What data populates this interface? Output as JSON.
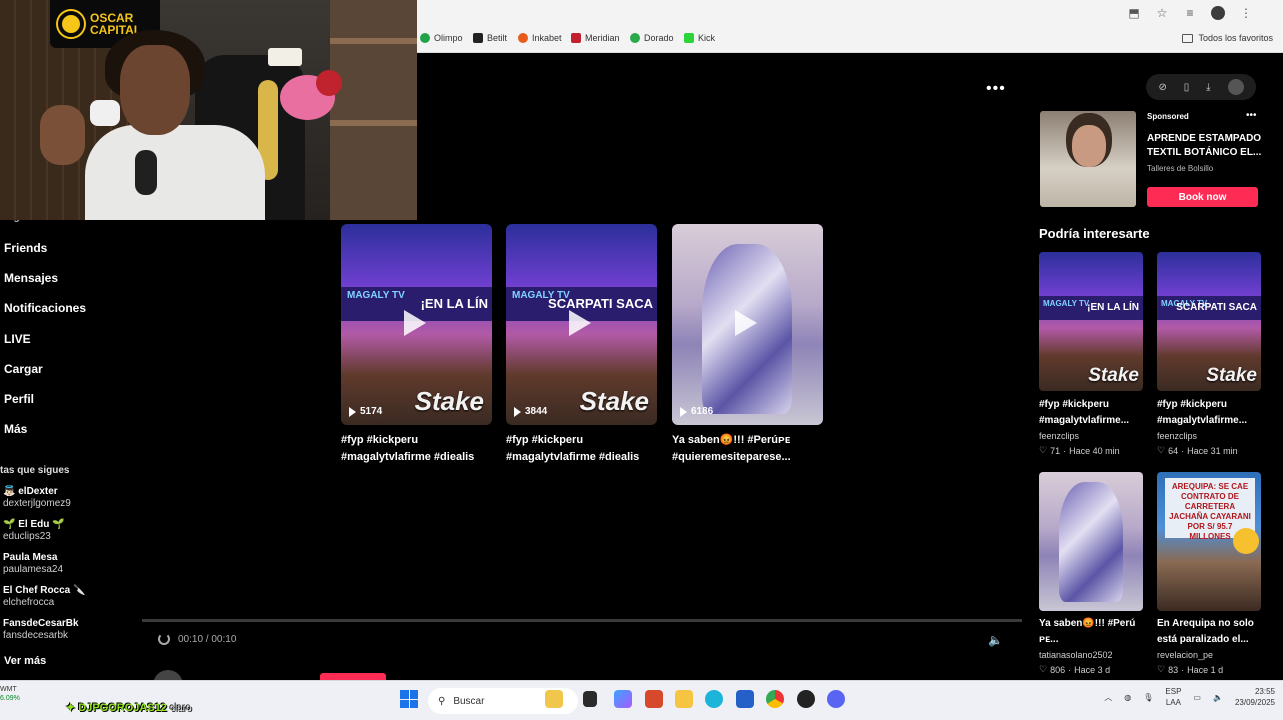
{
  "webcam": {
    "logo_text": "OSCAR CAPITAL"
  },
  "bookmarks": [
    {
      "label": "Olimpo",
      "color": "#22a34a"
    },
    {
      "label": "Betilt",
      "color": "#222222"
    },
    {
      "label": "Inkabet",
      "color": "#e85c1a"
    },
    {
      "label": "Meridian",
      "color": "#c2202f"
    },
    {
      "label": "Dorado",
      "color": "#2aa84a"
    },
    {
      "label": "Kick",
      "color": "#2bd43a"
    }
  ],
  "bookmarks_right": "Todos los favoritos",
  "sidebar": {
    "cut_label": "Siguiendo",
    "items": [
      "Friends",
      "Mensajes",
      "Notificaciones",
      "LIVE",
      "Cargar",
      "Perfil",
      "Más"
    ],
    "following_title": "tas que sigues",
    "following": [
      {
        "name": "👼🏻 elDexter",
        "handle": "dexterjlgomez9"
      },
      {
        "name": "🌱 El Edu 🌱",
        "handle": "educlips23"
      },
      {
        "name": "Paula Mesa",
        "handle": "paulamesa24"
      },
      {
        "name": "El Chef Rocca 🔪",
        "handle": "elchefrocca"
      },
      {
        "name": "FansdeCesarBk",
        "handle": "fansdecesarbk"
      }
    ],
    "see_more": "Ver más"
  },
  "main": {
    "videos": [
      {
        "views": "5174",
        "title": "#fyp #kickperu #magalytvlafirme #diealis",
        "band": "¡EN LA LÍN",
        "show": "MAGALY TV",
        "brand": "Stake"
      },
      {
        "views": "3844",
        "title": "#fyp #kickperu #magalytvlafirme #diealis",
        "band": "SCARPATI SACA",
        "show": "MAGALY TV",
        "brand": "Stake"
      },
      {
        "views": "6186",
        "title": "Ya saben😡!!! #Perúᴘᴇ #quieremesiteparese..."
      }
    ],
    "time": "00:10 / 00:10",
    "author": "feenzclips"
  },
  "right": {
    "ad": {
      "sponsored": "Sponsored",
      "title": "APRENDE ESTAMPADO TEXTIL BOTÁNICO EL...",
      "brand": "Talleres de Bolsillo",
      "cta": "Book now"
    },
    "rec_title": "Podría interesarte",
    "recs": [
      {
        "caption": "#fyp #kickperu #magalytvlafirme...",
        "author": "feenzclips",
        "likes": "71",
        "time": "Hace 40 min",
        "kind": "magaly",
        "band": "¡EN LA LÍN",
        "show": "MAGALY TV"
      },
      {
        "caption": "#fyp #kickperu #magalytvlafirme...",
        "author": "feenzclips",
        "likes": "64",
        "time": "Hace 31 min",
        "kind": "magaly",
        "band": "SCARPATI SACA",
        "show": "MAGALY TV"
      },
      {
        "caption": "Ya saben😡!!! #Perú ᴘᴇ...",
        "author": "tatianasolano2502",
        "likes": "806",
        "time": "Hace 3 d",
        "kind": "dress"
      },
      {
        "caption": "En Arequipa no solo está paralizado el...",
        "author": "revelacion_pe",
        "likes": "83",
        "time": "Hace 1 d",
        "kind": "news",
        "headline": "AREQUIPA: SE CAE CONTRATO DE CARRETERA JACHAÑA CAYARANI POR S/ 95.7 MILLONES"
      }
    ],
    "likes_separator": "·"
  },
  "taskbar": {
    "left_top": "WMT",
    "left_bottom": "6.09%",
    "search": "Buscar",
    "lang1": "ESP",
    "lang2": "LAA",
    "time": "23:55",
    "date": "23/09/2025"
  },
  "overlay": {
    "name": "DJPGOROJAS12",
    "sub": "claro"
  },
  "colors": {
    "accent": "#fe2c55",
    "bg": "#000000"
  }
}
